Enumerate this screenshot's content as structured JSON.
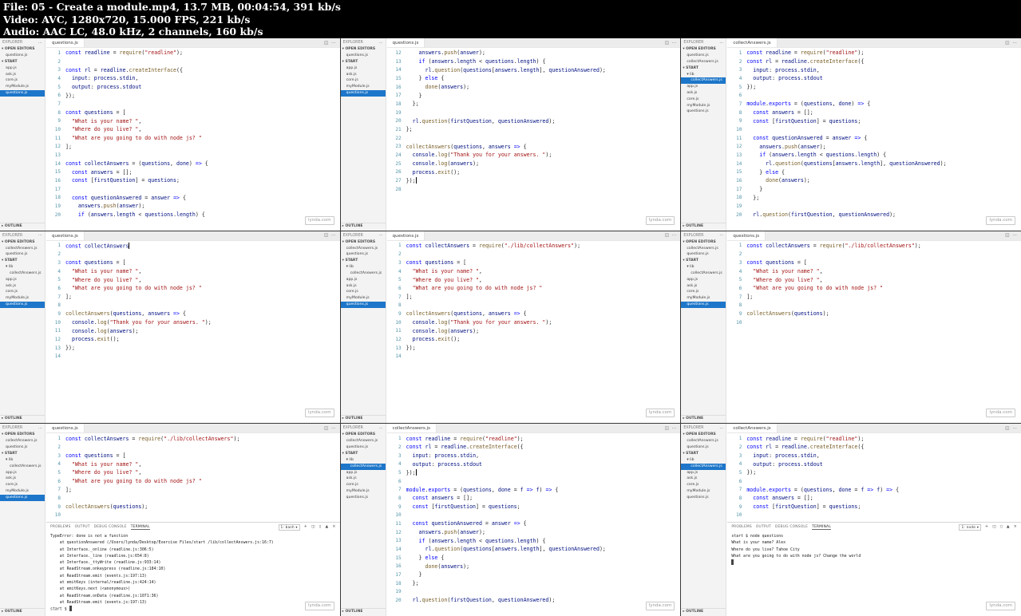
{
  "header": {
    "lines": [
      "File: 05 - Create a module.mp4, 13.7 MB, 00:04:54, 391 kb/s",
      "Video: AVC, 1280x720, 15.000 FPS, 221 kb/s",
      "Audio: AAC LC, 48.0 kHz, 2 channels, 160 kb/s"
    ]
  },
  "watermark": "lynda.com",
  "colors": {
    "selection": "#1d76c9",
    "keyword": "#0000ff",
    "string": "#a31515",
    "function": "#795e26",
    "variable": "#001080",
    "number": "#098658",
    "line-number": "#237893",
    "sidebar-bg": "#f3f3f3",
    "tabbar-bg": "#ececec"
  },
  "ui": {
    "explorer_title": "EXPLORER",
    "open_editors_label": "OPEN EDITORS",
    "folder_label": "START",
    "outline_label": "OUTLINE",
    "panel_tabs": [
      "PROBLEMS",
      "OUTPUT",
      "DEBUG CONSOLE",
      "TERMINAL"
    ],
    "active_panel_tab": "TERMINAL",
    "icons": {
      "more": "⋯",
      "chevron_down": "▾",
      "chevron_right": "▸",
      "split": "◫"
    },
    "terminal_icons": [
      {
        "name": "add-terminal-icon",
        "glyph": "+"
      },
      {
        "name": "split-terminal-icon",
        "glyph": "◫"
      },
      {
        "name": "trash-terminal-icon",
        "glyph": "▯"
      },
      {
        "name": "maximize-panel-icon",
        "glyph": "▲"
      },
      {
        "name": "close-panel-icon",
        "glyph": "×"
      }
    ]
  },
  "frames": [
    {
      "tab": "questions.js",
      "open_editors": [
        "questions.js"
      ],
      "files": [
        {
          "name": "app.js"
        },
        {
          "name": "ask.js"
        },
        {
          "name": "core.js"
        },
        {
          "name": "myModule.js"
        },
        {
          "name": "questions.js",
          "active": true
        }
      ],
      "first_line": 1,
      "code": [
        "const readline = require(\"readline\");",
        "",
        "const rl = readline.createInterface({",
        "  input: process.stdin,",
        "  output: process.stdout",
        "});",
        "",
        "const questions = [",
        "  \"What is your name? \",",
        "  \"Where do you live? \",",
        "  \"What are you going to do with node js? \"",
        "];",
        "",
        "const collectAnswers = (questions, done) => {",
        "  const answers = [];",
        "  const [firstQuestion] = questions;",
        "",
        "  const questionAnswered = answer => {",
        "    answers.push(answer);",
        "    if (answers.length < questions.length) {"
      ]
    },
    {
      "tab": "questions.js",
      "open_editors": [
        "questions.js"
      ],
      "files": [
        {
          "name": "app.js"
        },
        {
          "name": "ask.js"
        },
        {
          "name": "core.js"
        },
        {
          "name": "myModule.js"
        },
        {
          "name": "questions.js",
          "active": true
        }
      ],
      "first_line": 12,
      "cursor": {
        "line": 27
      },
      "code": [
        "    answers.push(answer);",
        "    if (answers.length < questions.length) {",
        "      rl.question(questions[answers.length], questionAnswered);",
        "    } else {",
        "      done(answers);",
        "    }",
        "  };",
        "",
        "  rl.question(firstQuestion, questionAnswered);",
        "};",
        "",
        "collectAnswers(questions, answers => {",
        "  console.log(\"Thank you for your answers. \");",
        "  console.log(answers);",
        "  process.exit();",
        "});",
        ""
      ]
    },
    {
      "tab": "collectAnswers.js",
      "open_editors": [
        "questions.js",
        "collectAnswers.js"
      ],
      "files": [
        {
          "name": "lib",
          "folder": true
        },
        {
          "name": "collectAnswers.js",
          "indent": 1,
          "active": true
        },
        {
          "name": "app.js"
        },
        {
          "name": "ask.js"
        },
        {
          "name": "core.js"
        },
        {
          "name": "myModule.js"
        },
        {
          "name": "questions.js"
        }
      ],
      "first_line": 1,
      "code": [
        "const readline = require(\"readline\");",
        "const rl = readline.createInterface({",
        "  input: process.stdin,",
        "  output: process.stdout",
        "});",
        "",
        "module.exports = (questions, done) => {",
        "  const answers = [];",
        "  const [firstQuestion] = questions;",
        "",
        "  const questionAnswered = answer => {",
        "    answers.push(answer);",
        "    if (answers.length < questions.length) {",
        "      rl.question(questions[answers.length], questionAnswered);",
        "    } else {",
        "      done(answers);",
        "    }",
        "  };",
        "",
        "  rl.question(firstQuestion, questionAnswered);"
      ]
    },
    {
      "tab": "questions.js",
      "open_editors": [
        "collectAnswers.js",
        "questions.js"
      ],
      "files": [
        {
          "name": "lib",
          "folder": true
        },
        {
          "name": "collectAnswers.js",
          "indent": 1
        },
        {
          "name": "app.js"
        },
        {
          "name": "ask.js"
        },
        {
          "name": "core.js"
        },
        {
          "name": "myModule.js"
        },
        {
          "name": "questions.js",
          "active": true
        }
      ],
      "first_line": 1,
      "cursor": {
        "line": 1
      },
      "code": [
        "const collectAnswers",
        "",
        "const questions = [",
        "  \"What is your name? \",",
        "  \"Where do you live? \",",
        "  \"What are you going to do with node js? \"",
        "];",
        "",
        "collectAnswers(questions, answers => {",
        "  console.log(\"Thank you for your answers. \");",
        "  console.log(answers);",
        "  process.exit();",
        "});",
        ""
      ]
    },
    {
      "tab": "questions.js",
      "open_editors": [
        "collectAnswers.js",
        "questions.js"
      ],
      "files": [
        {
          "name": "lib",
          "folder": true
        },
        {
          "name": "collectAnswers.js",
          "indent": 1
        },
        {
          "name": "app.js"
        },
        {
          "name": "ask.js"
        },
        {
          "name": "core.js"
        },
        {
          "name": "myModule.js"
        },
        {
          "name": "questions.js",
          "active": true
        }
      ],
      "first_line": 1,
      "code": [
        "const collectAnswers = require(\"./lib/collectAnswers\");",
        "",
        "const questions = [",
        "  \"What is your name? \",",
        "  \"Where do you live? \",",
        "  \"What are you going to do with node js? \"",
        "];",
        "",
        "collectAnswers(questions, answers => {",
        "  console.log(\"Thank you for your answers. \");",
        "  console.log(answers);",
        "  process.exit();",
        "});",
        ""
      ]
    },
    {
      "tab": "questions.js",
      "open_editors": [
        "collectAnswers.js",
        "questions.js"
      ],
      "files": [
        {
          "name": "lib",
          "folder": true
        },
        {
          "name": "collectAnswers.js",
          "indent": 1
        },
        {
          "name": "app.js"
        },
        {
          "name": "ask.js"
        },
        {
          "name": "core.js"
        },
        {
          "name": "myModule.js"
        },
        {
          "name": "questions.js",
          "active": true
        }
      ],
      "first_line": 1,
      "code": [
        "const collectAnswers = require(\"./lib/collectAnswers\");",
        "",
        "const questions = [",
        "  \"What is your name? \",",
        "  \"Where do you live? \",",
        "  \"What are you going to do with node js? \"",
        "];",
        "",
        "collectAnswers(questions);",
        ""
      ]
    },
    {
      "tab": "questions.js",
      "open_editors": [
        "collectAnswers.js",
        "questions.js"
      ],
      "files": [
        {
          "name": "lib",
          "folder": true
        },
        {
          "name": "collectAnswers.js",
          "indent": 1
        },
        {
          "name": "app.js"
        },
        {
          "name": "ask.js"
        },
        {
          "name": "core.js"
        },
        {
          "name": "myModule.js"
        },
        {
          "name": "questions.js",
          "active": true
        }
      ],
      "first_line": 1,
      "code": [
        "const collectAnswers = require(\"./lib/collectAnswers\");",
        "",
        "const questions = [",
        "  \"What is your name? \",",
        "  \"Where do you live? \",",
        "  \"What are you going to do with node js? \"",
        "];",
        "",
        "collectAnswers(questions);",
        ""
      ],
      "terminal": {
        "shell": "1: bash",
        "lines": [
          "TypeError: done is not a function",
          "    at questionAnswered (/Users/lynda/Desktop/Exercise Files/start /lib/collectAnswers.js:16:7)",
          "    at Interface._online (readline.js:306:5)",
          "    at Interface._line (readline.js:654:8)",
          "    at Interface._ttyWrite (readline.js:933:14)",
          "    at ReadStream.onkeypress (readline.js:184:10)",
          "    at ReadStream.emit (events.js:197:13)",
          "    at emitKeys (internal/readline.js:424:14)",
          "    at emitKeys.next (<anonymous>)",
          "    at ReadStream.onData (readline.js:1071:36)",
          "    at ReadStream.emit (events.js:197:13)",
          "start $ "
        ]
      }
    },
    {
      "tab": "collectAnswers.js",
      "open_editors": [
        "collectAnswers.js",
        "questions.js"
      ],
      "files": [
        {
          "name": "lib",
          "folder": true
        },
        {
          "name": "collectAnswers.js",
          "indent": 1,
          "active": true
        },
        {
          "name": "app.js"
        },
        {
          "name": "ask.js"
        },
        {
          "name": "core.js"
        },
        {
          "name": "myModule.js"
        },
        {
          "name": "questions.js"
        }
      ],
      "first_line": 1,
      "cursor": {
        "line": 5
      },
      "code": [
        "const readline = require(\"readline\");",
        "const rl = readline.createInterface({",
        "  input: process.stdin,",
        "  output: process.stdout",
        "});",
        "",
        "module.exports = (questions, done = f => f) => {",
        "  const answers = [];",
        "  const [firstQuestion] = questions;",
        "",
        "  const questionAnswered = answer => {",
        "    answers.push(answer);",
        "    if (answers.length < questions.length) {",
        "      rl.question(questions[answers.length], questionAnswered);",
        "    } else {",
        "      done(answers);",
        "    }",
        "  };",
        "",
        "  rl.question(firstQuestion, questionAnswered);"
      ]
    },
    {
      "tab": "collectAnswers.js",
      "open_editors": [
        "collectAnswers.js",
        "questions.js"
      ],
      "files": [
        {
          "name": "lib",
          "folder": true
        },
        {
          "name": "collectAnswers.js",
          "indent": 1,
          "active": true
        },
        {
          "name": "app.js"
        },
        {
          "name": "ask.js"
        },
        {
          "name": "core.js"
        },
        {
          "name": "myModule.js"
        },
        {
          "name": "questions.js"
        }
      ],
      "first_line": 1,
      "code": [
        "const readline = require(\"readline\");",
        "const rl = readline.createInterface({",
        "  input: process.stdin,",
        "  output: process.stdout",
        "});",
        "",
        "module.exports = (questions, done = f => f) => {",
        "  const answers = [];",
        "  const [firstQuestion] = questions;",
        ""
      ],
      "terminal": {
        "shell": "1: node",
        "lines": [
          "start $ node questions",
          "What is your name? Alex",
          "Where do you live? Tahoe City",
          "What are you going to do with node js? Change the world",
          ""
        ]
      }
    }
  ]
}
